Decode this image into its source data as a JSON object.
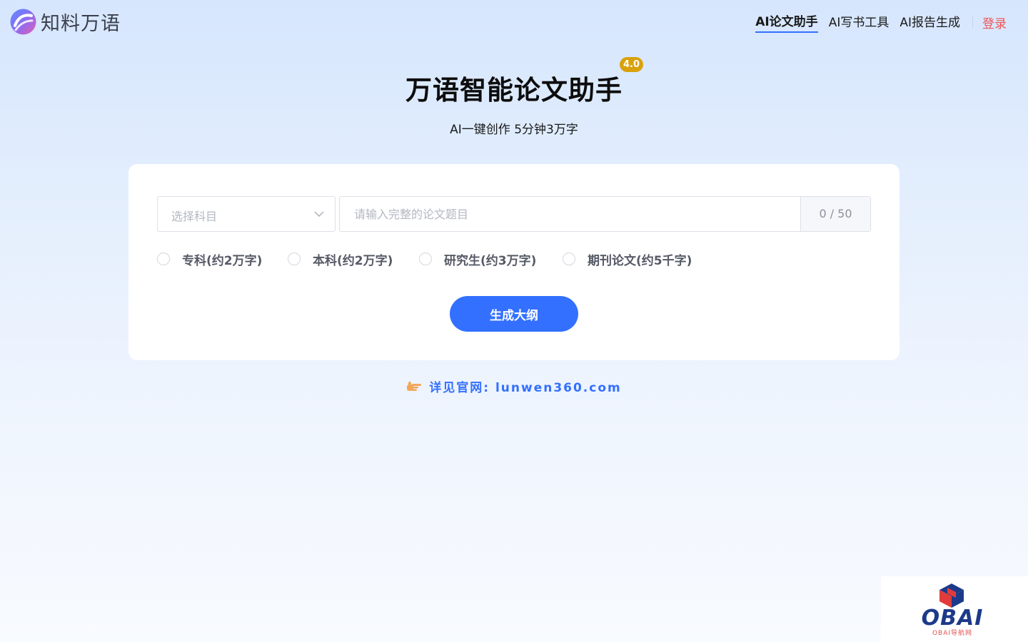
{
  "header": {
    "brand": "知料万语",
    "nav": [
      {
        "label": "AI论文助手",
        "active": true
      },
      {
        "label": "AI写书工具",
        "active": false
      },
      {
        "label": "AI报告生成",
        "active": false
      }
    ],
    "login": "登录"
  },
  "hero": {
    "title": "万语智能论文助手",
    "version": "4.0",
    "subtitle": "AI一键创作 5分钟3万字"
  },
  "form": {
    "subject_placeholder": "选择科目",
    "topic_placeholder": "请输入完整的论文题目",
    "topic_value": "",
    "counter": "0 / 50",
    "levels": [
      "专科(约2万字)",
      "本科(约2万字)",
      "研究生(约3万字)",
      "期刊论文(约5千字)"
    ],
    "generate_label": "生成大纲"
  },
  "footer": {
    "website": "详见官网: lunwen360.com"
  },
  "watermark": {
    "text": "OBAI",
    "subtext": "OBAI导航网"
  },
  "colors": {
    "accent": "#3370ff",
    "login": "#f05454",
    "badge": "#d9a10c"
  },
  "icons": [
    "chevron-down-icon",
    "pointing-hand-icon",
    "cube-logo-icon"
  ]
}
